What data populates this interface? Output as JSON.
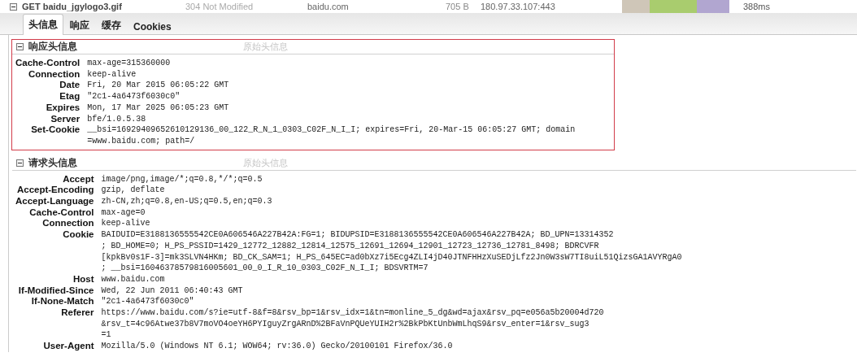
{
  "request": {
    "expanded": true,
    "method": "GET",
    "file": "baidu_jgylogo3.gif",
    "status": "304 Not Modified",
    "domain": "baidu.com",
    "size": "705 B",
    "remote": "180.97.33.107:443",
    "timing": "388ms"
  },
  "tabs": [
    {
      "label": "头信息",
      "selected": true
    },
    {
      "label": "响应",
      "selected": false
    },
    {
      "label": "缓存",
      "selected": false
    },
    {
      "label": "Cookies",
      "selected": false
    }
  ],
  "sections": [
    {
      "title": "响应头信息",
      "raw_link": "原始头信息",
      "expanded": true,
      "highlighted": true,
      "headers": [
        {
          "name": "Cache-Control",
          "lines": [
            "max-age=315360000"
          ]
        },
        {
          "name": "Connection",
          "lines": [
            "keep-alive"
          ]
        },
        {
          "name": "Date",
          "lines": [
            "Fri, 20 Mar 2015 06:05:22 GMT"
          ]
        },
        {
          "name": "Etag",
          "lines": [
            "\"2c1-4a6473f6030c0\""
          ]
        },
        {
          "name": "Expires",
          "lines": [
            "Mon, 17 Mar 2025 06:05:23 GMT"
          ]
        },
        {
          "name": "Server",
          "lines": [
            "bfe/1.0.5.38"
          ]
        },
        {
          "name": "Set-Cookie",
          "lines": [
            "__bsi=16929409652610129136_00_122_R_N_1_0303_C02F_N_I_I; expires=Fri, 20-Mar-15 06:05:27 GMT; domain",
            "=www.baidu.com; path=/"
          ]
        }
      ]
    },
    {
      "title": "请求头信息",
      "raw_link": "原始头信息",
      "expanded": true,
      "highlighted": false,
      "headers": [
        {
          "name": "Accept",
          "lines": [
            "image/png,image/*;q=0.8,*/*;q=0.5"
          ]
        },
        {
          "name": "Accept-Encoding",
          "lines": [
            "gzip, deflate"
          ]
        },
        {
          "name": "Accept-Language",
          "lines": [
            "zh-CN,zh;q=0.8,en-US;q=0.5,en;q=0.3"
          ]
        },
        {
          "name": "Cache-Control",
          "lines": [
            "max-age=0"
          ]
        },
        {
          "name": "Connection",
          "lines": [
            "keep-alive"
          ]
        },
        {
          "name": "Cookie",
          "lines": [
            "BAIDUID=E3188136555542CE0A606546A227B42A:FG=1; BIDUPSID=E3188136555542CE0A606546A227B42A; BD_UPN=13314352",
            "; BD_HOME=0; H_PS_PSSID=1429_12772_12882_12814_12575_12691_12694_12901_12723_12736_12781_8498; BDRCVFR",
            "[kpkBv0s1F-3]=mk3SLVN4HKm; BD_CK_SAM=1; H_PS_645EC=ad0bXz7i5Ecg4ZLI4jD40JTNFHHzXuSEDjLfz2Jn0W3sW7TI8uiL51QizsGA1AVYRgA0",
            "; __bsi=16046378579816005601_00_0_I_R_10_0303_C02F_N_I_I; BDSVRTM=7"
          ]
        },
        {
          "name": "Host",
          "lines": [
            "www.baidu.com"
          ]
        },
        {
          "name": "If-Modified-Since",
          "lines": [
            "Wed, 22 Jun 2011 06:40:43 GMT"
          ]
        },
        {
          "name": "If-None-Match",
          "lines": [
            "\"2c1-4a6473f6030c0\""
          ]
        },
        {
          "name": "Referer",
          "lines": [
            "https://www.baidu.com/s?ie=utf-8&f=8&rsv_bp=1&rsv_idx=1&tn=monline_5_dg&wd=ajax&rsv_pq=e056a5b20004d720",
            "&rsv_t=4c96Atwe37b8V7moVO4oeYH6PYIguyZrgARnD%2BFaVnPQUeYUIH2r%2BkPbKtUnbWmLhqS9&rsv_enter=1&rsv_sug3",
            "=1"
          ]
        },
        {
          "name": "User-Agent",
          "lines": [
            "Mozilla/5.0 (Windows NT 6.1; WOW64; rv:36.0) Gecko/20100101 Firefox/36.0"
          ]
        }
      ]
    }
  ]
}
